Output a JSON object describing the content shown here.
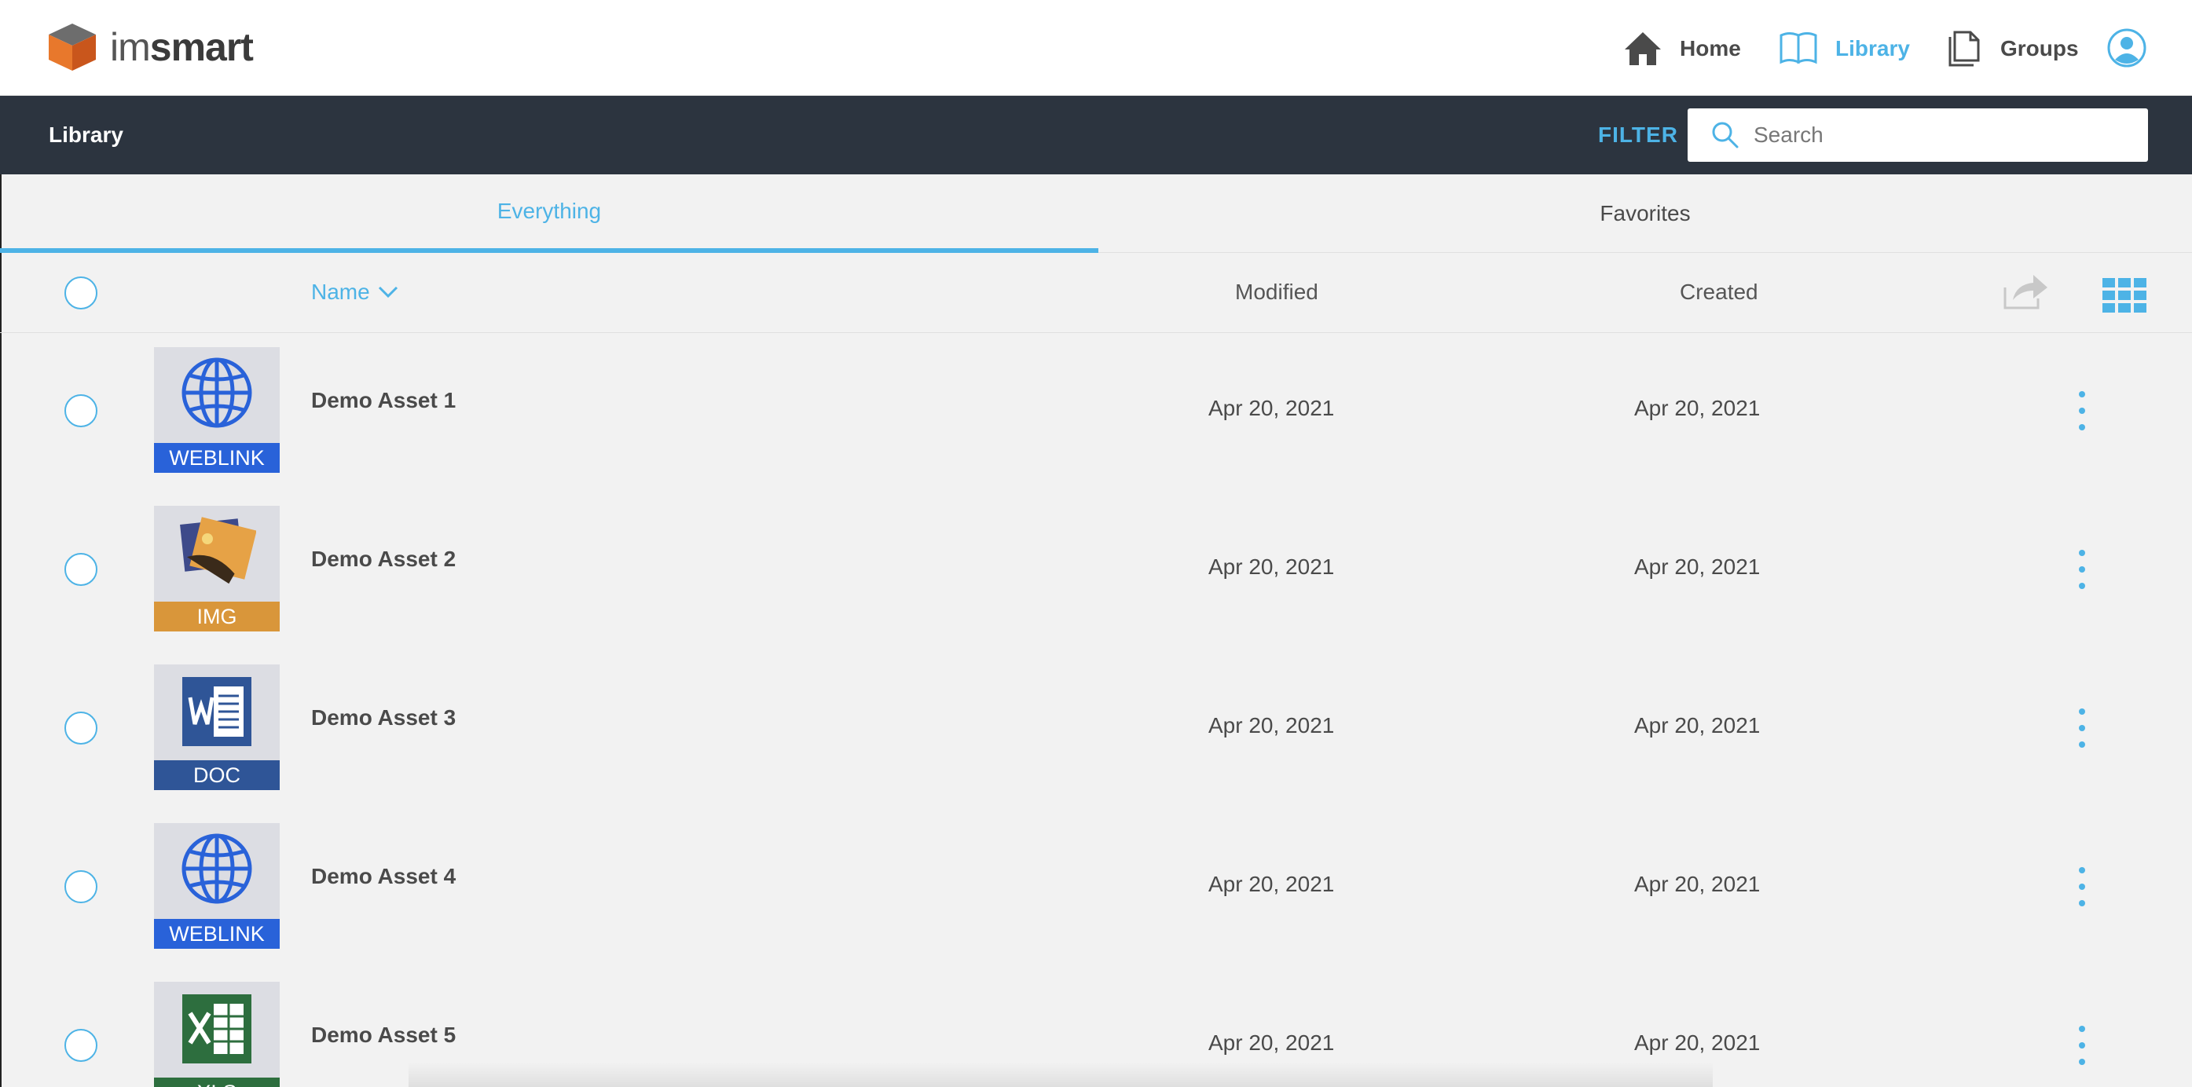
{
  "brand": {
    "name_light": "im",
    "name_bold": "smart"
  },
  "nav": {
    "home": "Home",
    "library": "Library",
    "groups": "Groups"
  },
  "subbar": {
    "title": "Library",
    "filter_label": "FILTER",
    "search_placeholder": "Search"
  },
  "tabs": [
    {
      "label": "Everything",
      "active": true
    },
    {
      "label": "Favorites",
      "active": false
    }
  ],
  "columns": {
    "name": "Name",
    "modified": "Modified",
    "created": "Created"
  },
  "assets": [
    {
      "name": "Demo Asset 1",
      "type": "WEBLINK",
      "modified": "Apr 20, 2021",
      "created": "Apr 20, 2021",
      "icon": "globe-icon",
      "band_color": "#2962d9"
    },
    {
      "name": "Demo Asset 2",
      "type": "IMG",
      "modified": "Apr 20, 2021",
      "created": "Apr 20, 2021",
      "icon": "image-icon",
      "band_color": "#d9963a"
    },
    {
      "name": "Demo Asset 3",
      "type": "DOC",
      "modified": "Apr 20, 2021",
      "created": "Apr 20, 2021",
      "icon": "word-icon",
      "band_color": "#2f5597"
    },
    {
      "name": "Demo Asset 4",
      "type": "WEBLINK",
      "modified": "Apr 20, 2021",
      "created": "Apr 20, 2021",
      "icon": "globe-icon",
      "band_color": "#2962d9"
    },
    {
      "name": "Demo Asset 5",
      "type": "XLS",
      "modified": "Apr 20, 2021",
      "created": "Apr 20, 2021",
      "icon": "excel-icon",
      "band_color": "#2d6e3e"
    }
  ],
  "colors": {
    "accent": "#4db3e6",
    "subbar_bg": "#2c343f",
    "page_bg": "#f2f2f2"
  }
}
